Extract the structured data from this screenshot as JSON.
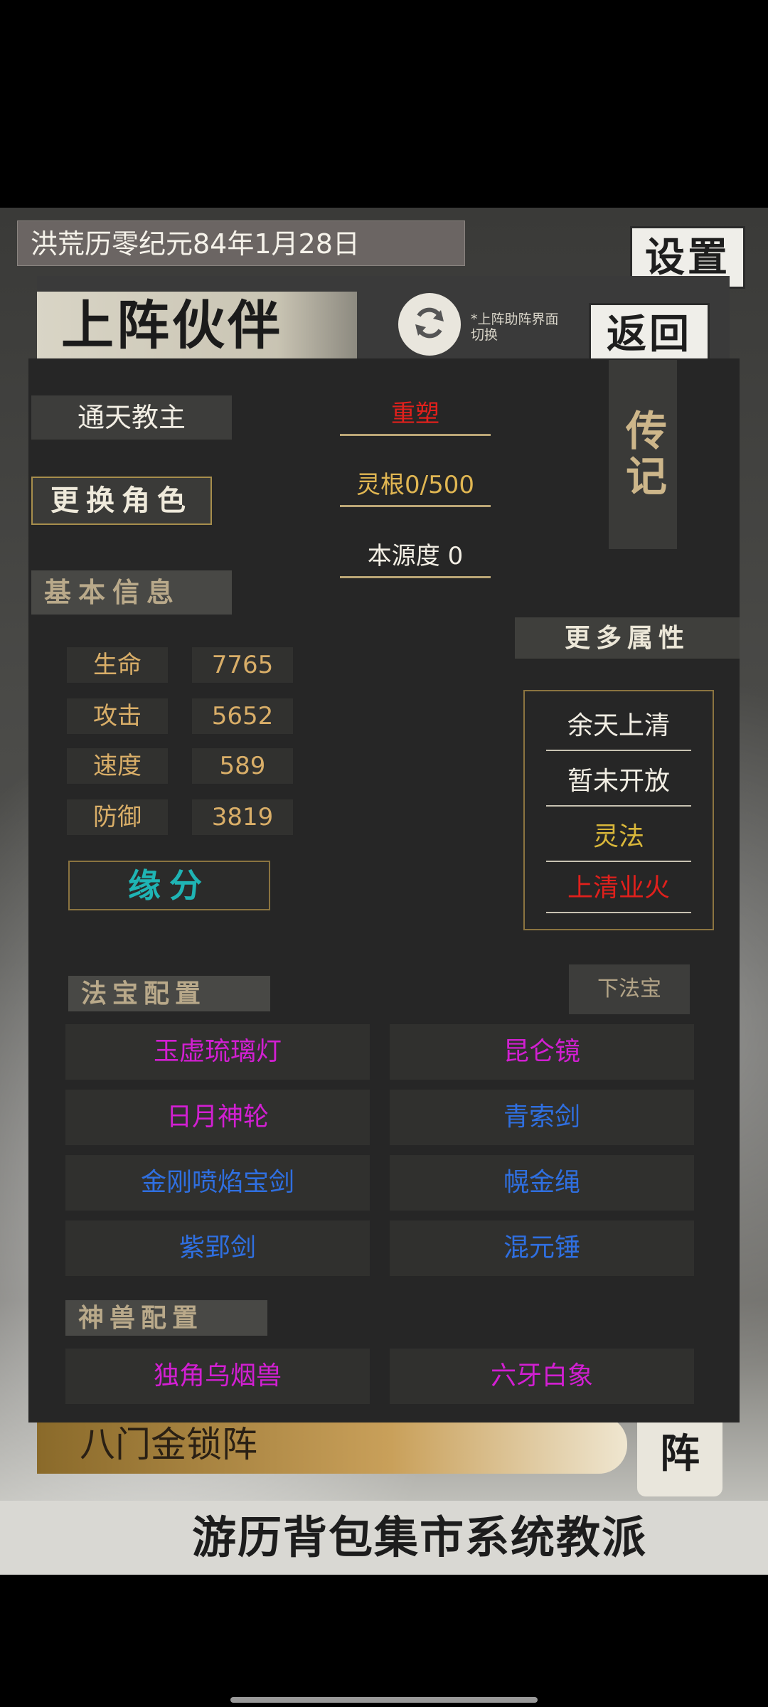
{
  "background": {
    "date_text": "洪荒历零纪元84年1月28日",
    "settings_label": "设置",
    "banner_text": "八门金锁阵",
    "formation_button": "阵",
    "bottom_nav": "游历背包集市系统教派"
  },
  "header": {
    "title": "上阵伙伴",
    "refresh_note": "*上阵助阵界面切换",
    "back_label": "返回"
  },
  "character": {
    "name": "通天教主",
    "change_role_label": "更换角色",
    "reshape_label": "重塑",
    "spirit_root": "灵根0/500",
    "origin_degree": "本源度 0",
    "biography_label": "传记"
  },
  "basic_info": {
    "title": "基本信息",
    "stats": [
      {
        "label": "生命",
        "value": "7765"
      },
      {
        "label": "攻击",
        "value": "5652"
      },
      {
        "label": "速度",
        "value": "589"
      },
      {
        "label": "防御",
        "value": "3819"
      }
    ],
    "fate_label": "缘分"
  },
  "more_attributes": {
    "title": "更多属性",
    "items": [
      {
        "label": "余天上清",
        "color": "#f2eee4"
      },
      {
        "label": "暂未开放",
        "color": "#f2eee4"
      },
      {
        "label": "灵法",
        "color": "#d9b73a"
      },
      {
        "label": "上清业火",
        "color": "#e0201c"
      }
    ]
  },
  "treasures": {
    "title": "法宝配置",
    "unequip_label": "下法宝",
    "slots": [
      {
        "name": "玉虚琉璃灯",
        "color": "#d21fd2"
      },
      {
        "name": "昆仑镜",
        "color": "#d21fd2"
      },
      {
        "name": "日月神轮",
        "color": "#d21fd2"
      },
      {
        "name": "青索剑",
        "color": "#2f6fe0"
      },
      {
        "name": "金刚喷焰宝剑",
        "color": "#2f6fe0"
      },
      {
        "name": "幌金绳",
        "color": "#2f6fe0"
      },
      {
        "name": "紫郢剑",
        "color": "#2f6fe0"
      },
      {
        "name": "混元锤",
        "color": "#2f6fe0"
      }
    ]
  },
  "beasts": {
    "title": "神兽配置",
    "slots": [
      {
        "name": "独角乌烟兽",
        "color": "#d21fd2"
      },
      {
        "name": "六牙白象",
        "color": "#d21fd2"
      }
    ]
  },
  "icons": {
    "refresh": "refresh-icon"
  }
}
